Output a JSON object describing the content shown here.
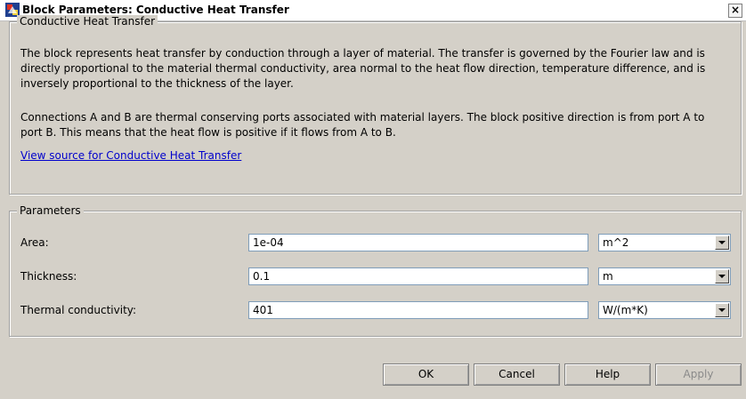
{
  "window": {
    "title": "Block Parameters: Conductive Heat Transfer",
    "close_symbol": "×"
  },
  "description_group": {
    "legend": "Conductive Heat Transfer",
    "para1_lines": [
      "The block represents heat transfer by conduction through a layer of material. The transfer is governed by the Fourier law and is",
      "directly proportional to the material thermal conductivity, area normal to the heat flow direction, temperature difference, and is",
      "inversely proportional to the thickness of the layer."
    ],
    "para2_lines": [
      "Connections A and B are thermal conserving ports associated with material layers. The block positive direction is from port A to",
      "port B. This means that the heat flow is positive if it flows from A to B."
    ],
    "source_link": "View source for Conductive Heat Transfer"
  },
  "parameters_group": {
    "legend": "Parameters",
    "rows": [
      {
        "label": "Area:",
        "value": "1e-04",
        "unit": "m^2"
      },
      {
        "label": "Thickness:",
        "value": "0.1",
        "unit": "m"
      },
      {
        "label": "Thermal conductivity:",
        "value": "401",
        "unit": "W/(m*K)"
      }
    ]
  },
  "buttons": {
    "ok": "OK",
    "cancel": "Cancel",
    "help": "Help",
    "apply": "Apply"
  },
  "colors": {
    "link": "#0000cc",
    "dialog_bg": "#d4d0c8",
    "disabled_text": "#8a8a8a"
  }
}
